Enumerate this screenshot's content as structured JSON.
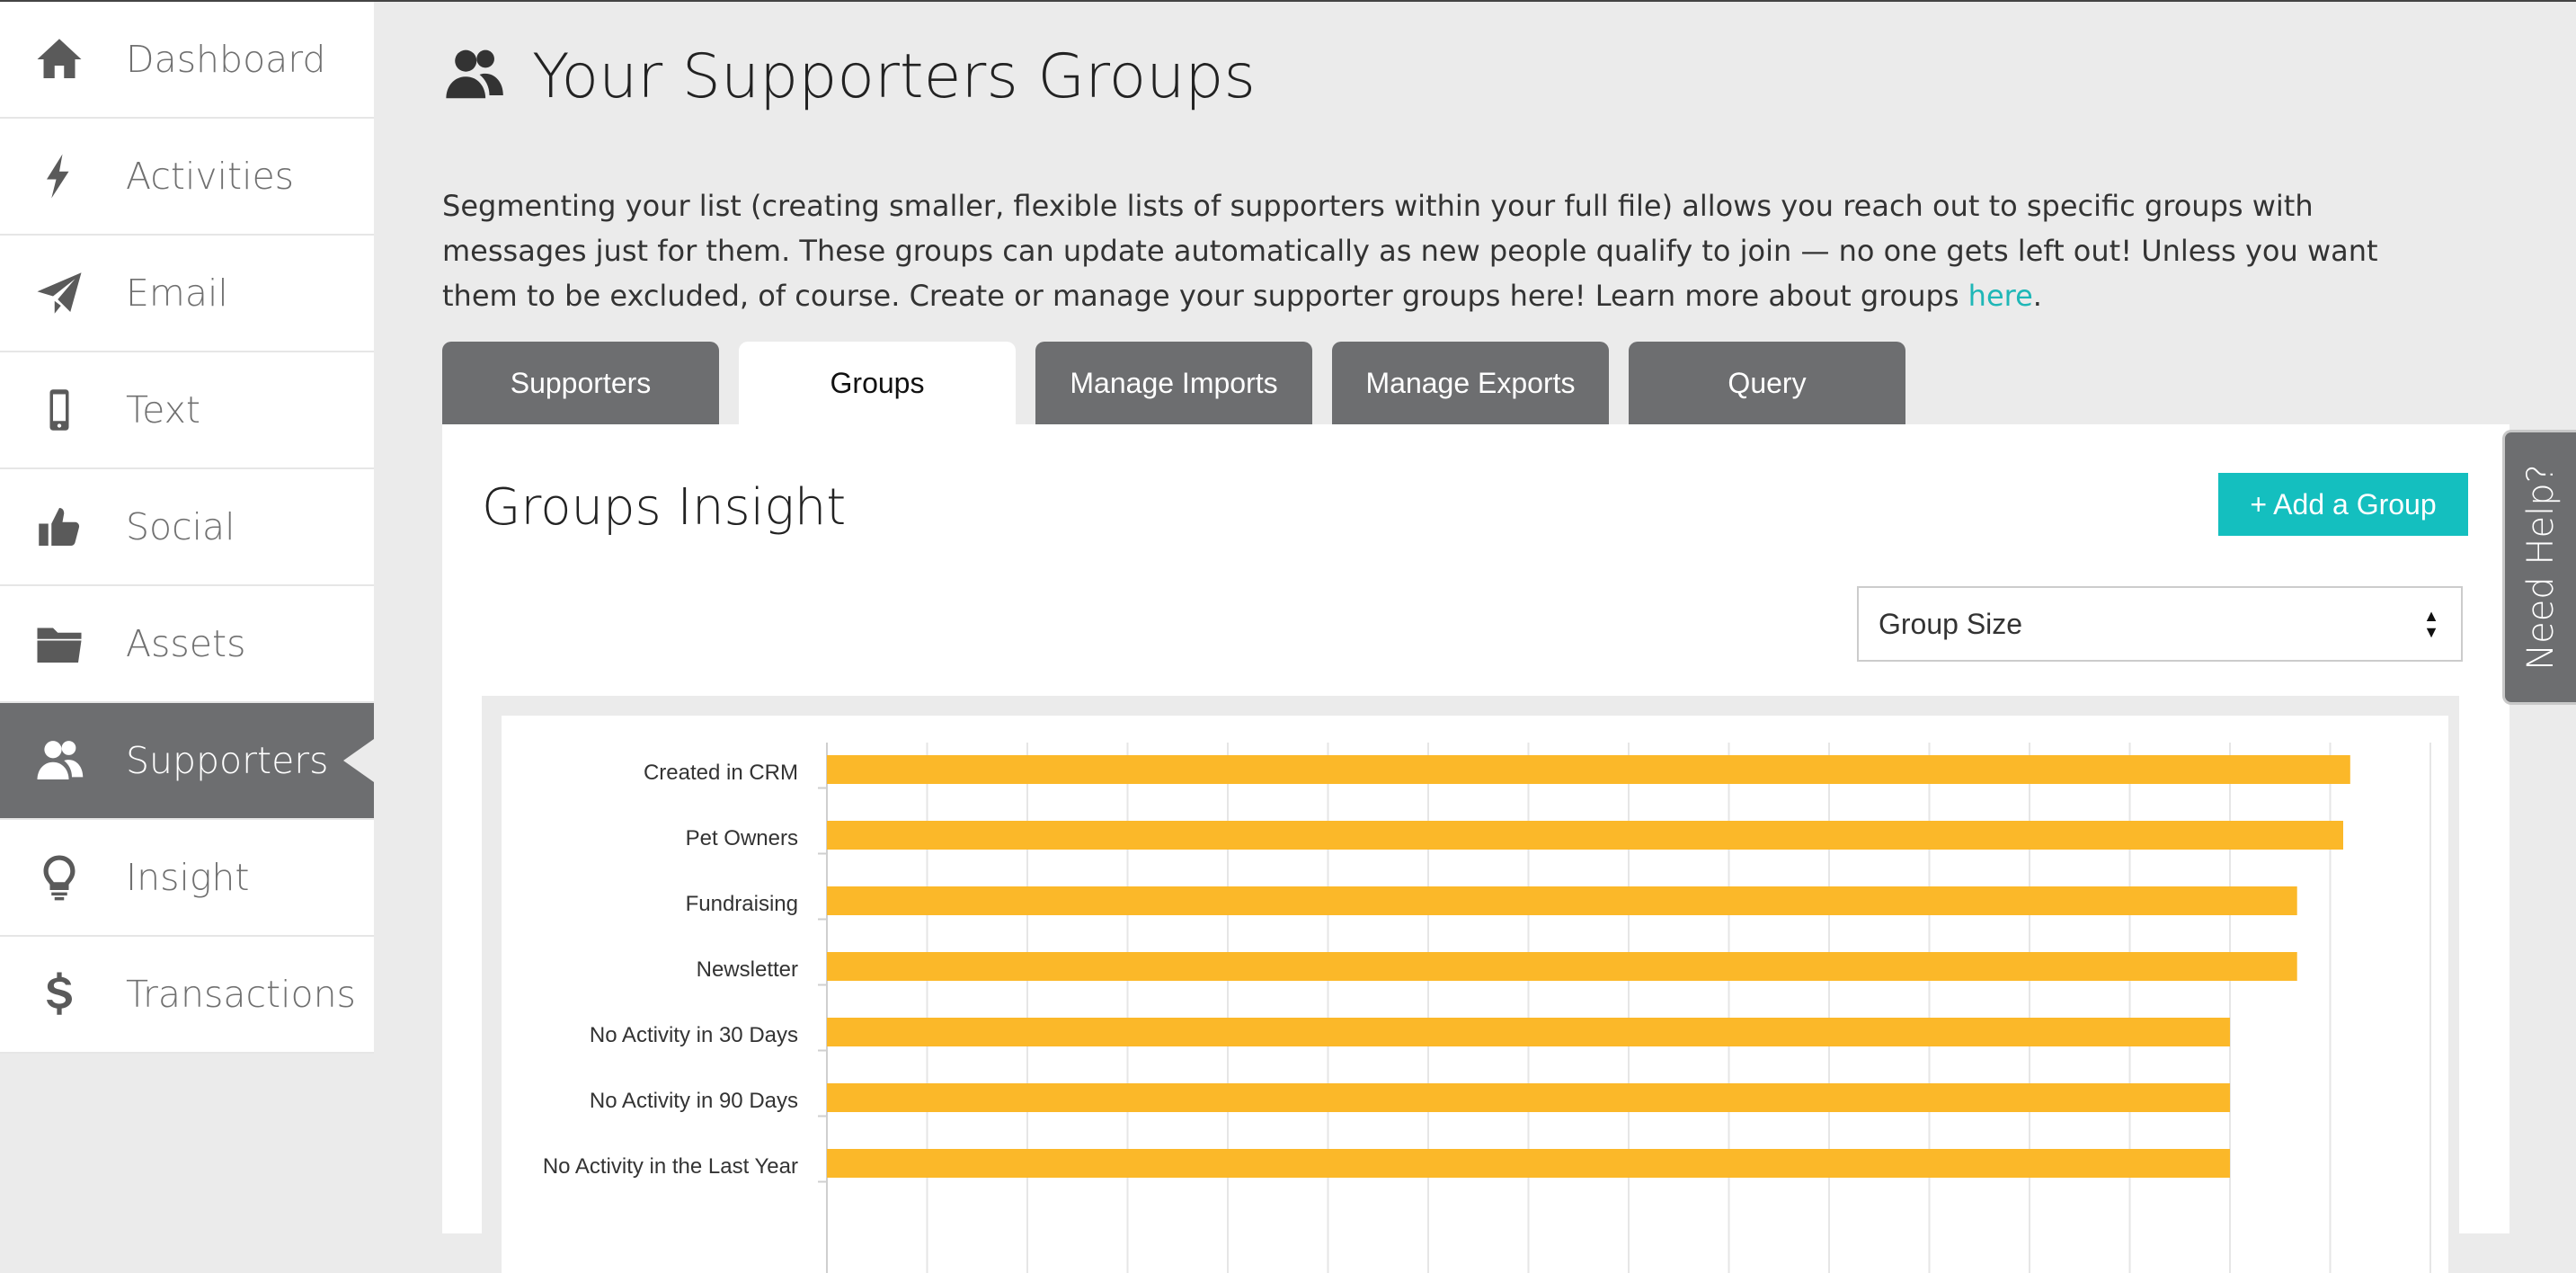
{
  "sidebar": {
    "items": [
      {
        "label": "Dashboard",
        "icon": "home-icon"
      },
      {
        "label": "Activities",
        "icon": "lightning-icon"
      },
      {
        "label": "Email",
        "icon": "paper-plane-icon"
      },
      {
        "label": "Text",
        "icon": "mobile-phone-icon"
      },
      {
        "label": "Social",
        "icon": "thumbs-up-icon"
      },
      {
        "label": "Assets",
        "icon": "folder-icon"
      },
      {
        "label": "Supporters",
        "icon": "users-icon",
        "active": true
      },
      {
        "label": "Insight",
        "icon": "lightbulb-icon"
      },
      {
        "label": "Transactions",
        "icon": "dollar-icon"
      }
    ]
  },
  "header": {
    "title": "Your Supporters Groups",
    "icon": "users-icon"
  },
  "intro": {
    "text": "Segmenting your list (creating smaller, flexible lists of supporters within your full file) allows you reach out to specific groups with messages just for them. These groups can update automatically as new people qualify to join — no one gets left out! Unless you want them to be excluded, of course. Create or manage your supporter groups here! Learn more about groups ",
    "link_text": "here",
    "after_link": "."
  },
  "tabs": [
    {
      "label": "Supporters"
    },
    {
      "label": "Groups",
      "active": true
    },
    {
      "label": "Manage Imports"
    },
    {
      "label": "Manage Exports"
    },
    {
      "label": "Query"
    }
  ],
  "panel": {
    "title": "Groups Insight",
    "add_button": "+ Add a Group",
    "select_value": "Group Size"
  },
  "help_tab": "Need Help?",
  "colors": {
    "accent": "#14bfbf",
    "bar": "#fbb829",
    "sidebar_active": "#6d6e70"
  },
  "chart_data": {
    "type": "bar",
    "orientation": "horizontal",
    "categories": [
      "Created in CRM",
      "Pet Owners",
      "Fundraising",
      "Newsletter",
      "No Activity in 30 Days",
      "No Activity in 90 Days",
      "No Activity in the Last Year"
    ],
    "values": [
      15.2,
      15.13,
      14.67,
      14.67,
      14,
      14,
      14
    ],
    "xlim": [
      0,
      16
    ],
    "grid": true
  }
}
